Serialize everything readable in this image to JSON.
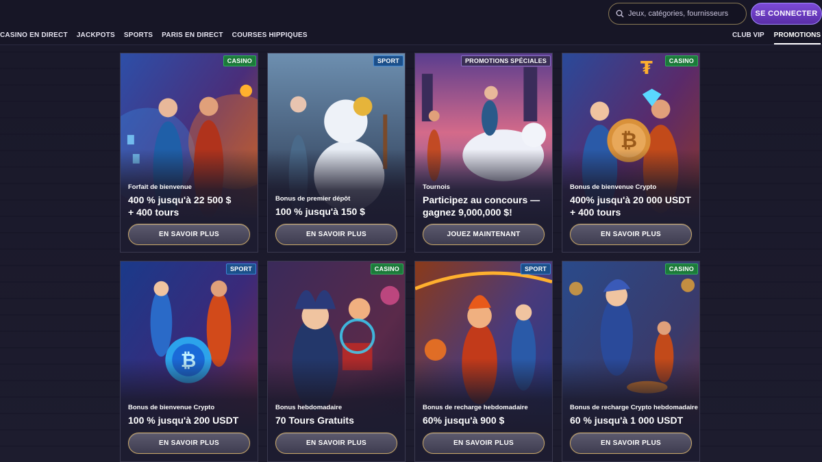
{
  "header": {
    "search_placeholder": "Jeux, catégories, fournisseurs",
    "login_label": "SE CONNECTER",
    "nav_left": [
      "CASINO EN DIRECT",
      "JACKPOTS",
      "SPORTS",
      "PARIS EN DIRECT",
      "COURSES HIPPIQUES"
    ],
    "nav_right": [
      {
        "label": "CLUB VIP",
        "active": false
      },
      {
        "label": "PROMOTIONS",
        "active": true
      }
    ]
  },
  "colors": {
    "casino_tag": "#1c7a3a",
    "sport_tag": "#1b4f8a",
    "promo_tag": "#3a2e55",
    "login_button": "#6a3bc4",
    "cta_border": "#c9a86a"
  },
  "promotions": [
    {
      "tag": "CASINO",
      "tag_type": "casino",
      "subtitle": "Forfait de bienvenue",
      "title_line1": "400 % jusqu'à 22 500 $",
      "title_line2": "+ 400 tours",
      "cta": "EN SAVOIR PLUS",
      "art": "mages-fire-ice"
    },
    {
      "tag": "SPORT",
      "tag_type": "sport",
      "subtitle": "Bonus de premier dépôt",
      "title_line1": "100 % jusqu'à 150 $",
      "title_line2": "",
      "cta": "EN SAVOIR PLUS",
      "art": "snowman-hockey"
    },
    {
      "tag": "PROMOTIONS SPÉCIALES",
      "tag_type": "promo",
      "subtitle": "Tournois",
      "title_line1": "Participez au concours —",
      "title_line2": "gagnez 9,000,000 $!",
      "cta": "JOUEZ MAINTENANT",
      "art": "polar-bear-rider"
    },
    {
      "tag": "CASINO",
      "tag_type": "casino",
      "subtitle": "Bonus de bienvenue Crypto",
      "title_line1": "400% jusqu'à 20 000 USDT",
      "title_line2": "+ 400 tours",
      "cta": "EN SAVOIR PLUS",
      "art": "bitcoin-jesters"
    },
    {
      "tag": "SPORT",
      "tag_type": "sport",
      "subtitle": "Bonus de bienvenue Crypto",
      "title_line1": "100 % jusqu'à 200 USDT",
      "title_line2": "",
      "cta": "EN SAVOIR PLUS",
      "art": "hockey-bitcoin"
    },
    {
      "tag": "CASINO",
      "tag_type": "casino",
      "subtitle": "Bonus hebdomadaire",
      "title_line1": "70 Tours Gratuits",
      "title_line2": "",
      "cta": "EN SAVOIR PLUS",
      "art": "jester-magic-box"
    },
    {
      "tag": "SPORT",
      "tag_type": "sport",
      "subtitle": "Bonus de recharge hebdomadaire",
      "title_line1": "60% jusqu'à 900 $",
      "title_line2": "",
      "cta": "EN SAVOIR PLUS",
      "art": "fire-skater"
    },
    {
      "tag": "CASINO",
      "tag_type": "casino",
      "subtitle": "Bonus de recharge Crypto hebdomadaire",
      "title_line1": "60 % jusqu'à 1 000 USDT",
      "title_line2": "",
      "cta": "EN SAVOIR PLUS",
      "art": "curling-jesters"
    }
  ]
}
